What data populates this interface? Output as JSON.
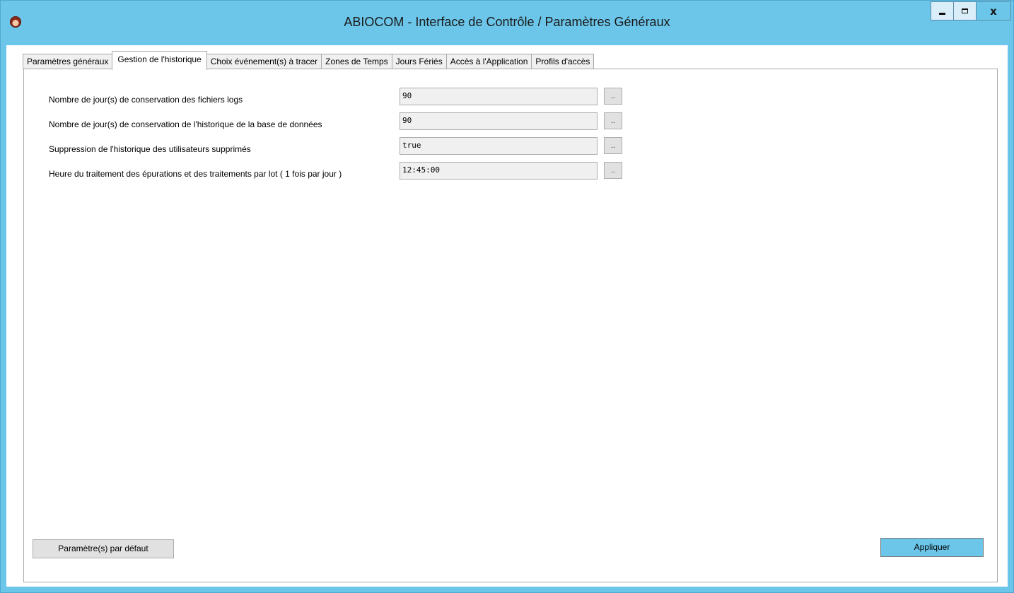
{
  "window": {
    "title": "ABIOCOM - Interface de Contrôle / Paramètres Généraux",
    "accent_color": "#6cc6ea",
    "controls": {
      "minimize_icon": "minimize-icon",
      "maximize_icon": "maximize-icon",
      "close_label": "x"
    }
  },
  "tabs": [
    {
      "label": "Paramètres généraux",
      "active": false
    },
    {
      "label": "Gestion de l'historique",
      "active": true
    },
    {
      "label": "Choix événement(s) à tracer",
      "active": false
    },
    {
      "label": "Zones de Temps",
      "active": false
    },
    {
      "label": "Jours Fériés",
      "active": false
    },
    {
      "label": "Accès à l'Application",
      "active": false
    },
    {
      "label": "Profils d'accès",
      "active": false
    }
  ],
  "settings": [
    {
      "label": "Nombre de jour(s) de conservation des fichiers logs",
      "value": "90",
      "button_label": ".."
    },
    {
      "label": "Nombre de jour(s) de conservation de l'historique de la base de données",
      "value": "90",
      "button_label": ".."
    },
    {
      "label": "Suppression de l'historique des utilisateurs supprimés",
      "value": "true",
      "button_label": ".."
    },
    {
      "label": "Heure du traitement des épurations et des traitements par lot ( 1 fois par jour )",
      "value": "12:45:00",
      "button_label": ".."
    }
  ],
  "footer": {
    "default_button_label": "Paramètre(s) par défaut",
    "apply_button_label": "Appliquer"
  }
}
